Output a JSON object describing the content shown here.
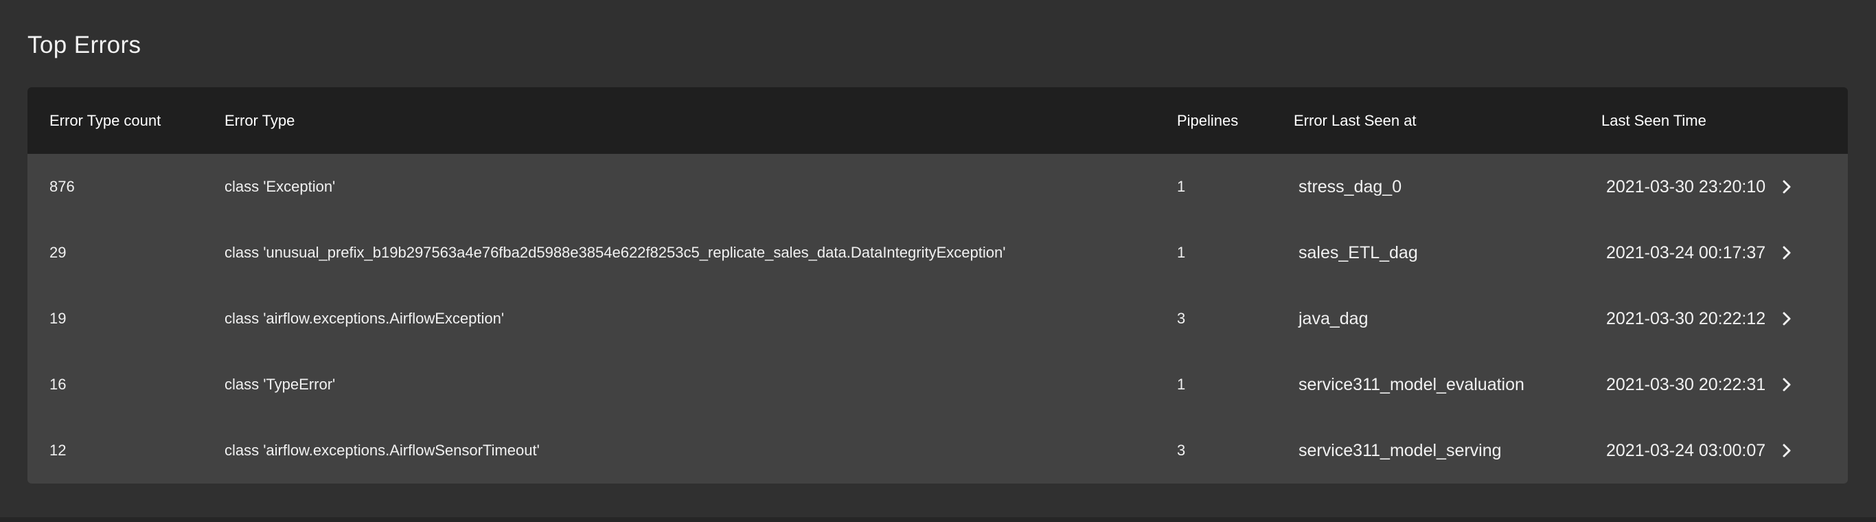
{
  "section": {
    "title": "Top Errors"
  },
  "table": {
    "headers": {
      "count": "Error Type count",
      "error_type": "Error Type",
      "pipelines": "Pipelines",
      "last_seen_at": "Error Last Seen at",
      "last_seen_time": "Last Seen Time"
    },
    "rows": [
      {
        "count": "876",
        "error_type": "class 'Exception'",
        "pipelines": "1",
        "last_seen_at": "stress_dag_0",
        "last_seen_time": "2021-03-30 23:20:10"
      },
      {
        "count": "29",
        "error_type": "class 'unusual_prefix_b19b297563a4e76fba2d5988e3854e622f8253c5_replicate_sales_data.DataIntegrityException'",
        "pipelines": "1",
        "last_seen_at": "sales_ETL_dag",
        "last_seen_time": "2021-03-24 00:17:37"
      },
      {
        "count": "19",
        "error_type": "class 'airflow.exceptions.AirflowException'",
        "pipelines": "3",
        "last_seen_at": "java_dag",
        "last_seen_time": "2021-03-30 20:22:12"
      },
      {
        "count": "16",
        "error_type": "class 'TypeError'",
        "pipelines": "1",
        "last_seen_at": "service311_model_evaluation",
        "last_seen_time": "2021-03-30 20:22:31"
      },
      {
        "count": "12",
        "error_type": "class 'airflow.exceptions.AirflowSensorTimeout'",
        "pipelines": "3",
        "last_seen_at": "service311_model_serving",
        "last_seen_time": "2021-03-24 03:00:07"
      }
    ],
    "row_action_icon": "chevron-right-icon"
  },
  "colors": {
    "background": "#303030",
    "header_background": "#1f1f1f",
    "row_background": "#424242",
    "text": "#f1f1f1"
  }
}
